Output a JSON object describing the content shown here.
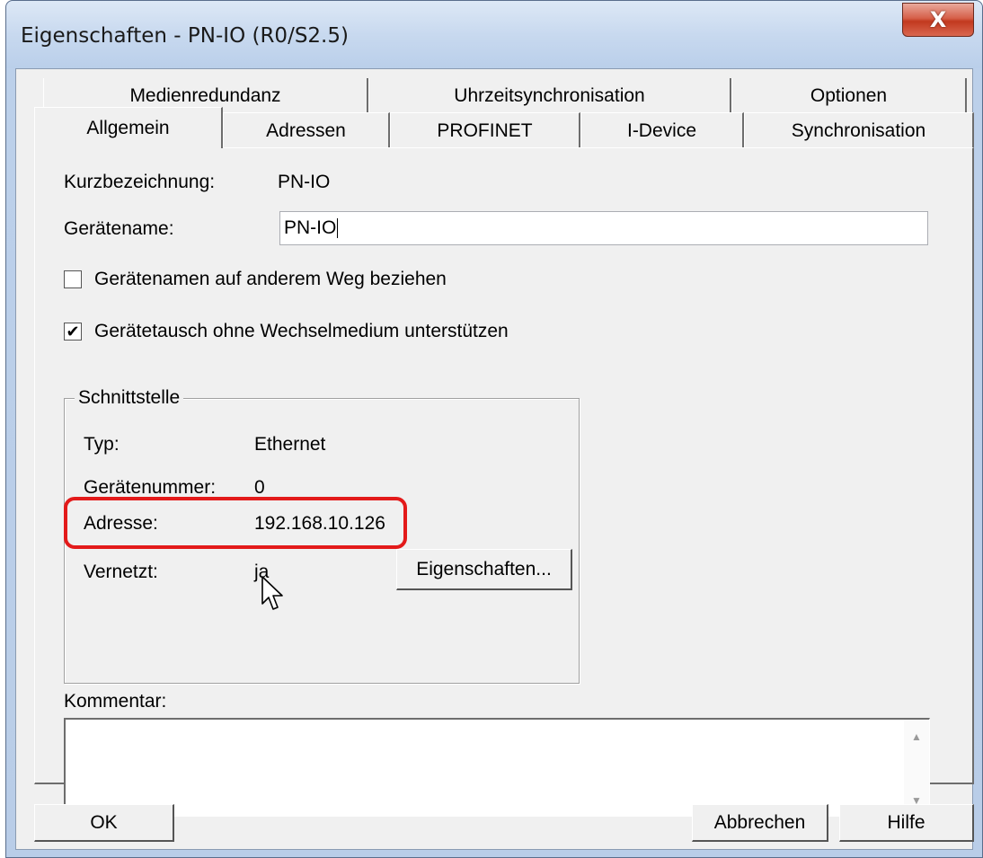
{
  "window": {
    "title": "Eigenschaften - PN-IO (R0/S2.5)",
    "close_glyph": "X"
  },
  "tabs": {
    "row1": [
      "Medienredundanz",
      "Uhrzeitsynchronisation",
      "Optionen"
    ],
    "row2": [
      "Allgemein",
      "Adressen",
      "PROFINET",
      "I-Device",
      "Synchronisation"
    ],
    "active": "Allgemein"
  },
  "general": {
    "short_label": "Kurzbezeichnung:",
    "short_value": "PN-IO",
    "device_name_label": "Gerätename:",
    "device_name_value": "PN-IO",
    "checkbox1": {
      "label": "Gerätenamen auf anderem Weg beziehen",
      "checked": false
    },
    "checkbox2": {
      "label": "Gerätetausch ohne Wechselmedium unterstützen",
      "checked": true,
      "check_glyph": "✔"
    }
  },
  "interface": {
    "title": "Schnittstelle",
    "type_label": "Typ:",
    "type_value": "Ethernet",
    "device_no_label": "Gerätenummer:",
    "device_no_value": "0",
    "address_label": "Adresse:",
    "address_value": "192.168.10.126",
    "networked_label": "Vernetzt:",
    "networked_value": "ja",
    "properties_button": "Eigenschaften..."
  },
  "comment": {
    "label": "Kommentar:",
    "value": ""
  },
  "footer": {
    "ok": "OK",
    "cancel": "Abbrechen",
    "help": "Hilfe"
  },
  "colors": {
    "highlight": "#e31a1a",
    "close_button": "#c2391f"
  },
  "icons": [
    "close-icon",
    "checkmark-icon",
    "scroll-up-icon",
    "scroll-down-icon",
    "mouse-cursor-icon"
  ]
}
